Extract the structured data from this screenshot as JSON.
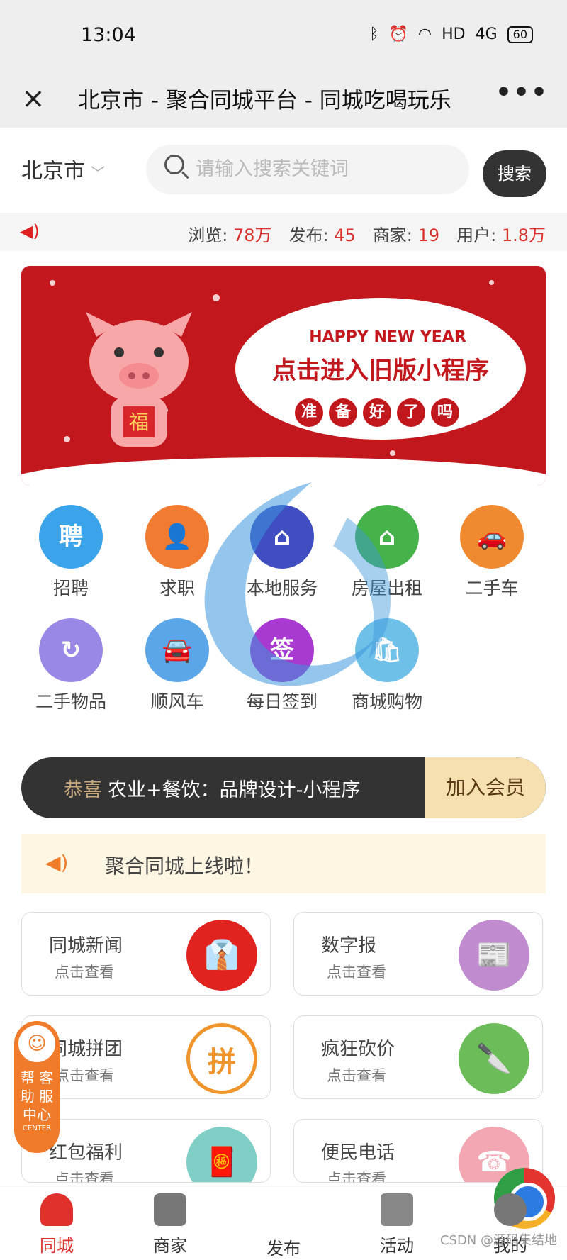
{
  "statusbar": {
    "time": "13:04",
    "network": "HD",
    "signal": "4G",
    "battery": "60"
  },
  "titlebar": {
    "close_label": "×",
    "title": "北京市 - 聚合同城平台 - 同城吃喝玩乐",
    "more_label": "•••"
  },
  "search": {
    "city": "北京市",
    "placeholder": "请输入搜索关键词",
    "button": "搜索"
  },
  "stats": [
    {
      "label": "浏览:",
      "value": "78万"
    },
    {
      "label": "发布:",
      "value": "45"
    },
    {
      "label": "商家:",
      "value": "19"
    },
    {
      "label": "用户:",
      "value": "1.8万"
    }
  ],
  "banner": {
    "headline": "HAPPY NEW YEAR",
    "main": "点击进入旧版小程序",
    "badges": [
      "准",
      "备",
      "好",
      "了",
      "吗"
    ],
    "pig_label": "福"
  },
  "grid": [
    {
      "label": "招聘",
      "glyph": "聘",
      "color": "#3aa3ea"
    },
    {
      "label": "求职",
      "glyph": "👤",
      "color": "#f27b32"
    },
    {
      "label": "本地服务",
      "glyph": "⌂",
      "color": "#3f4fc2"
    },
    {
      "label": "房屋出租",
      "glyph": "⌂",
      "color": "#46b24a"
    },
    {
      "label": "二手车",
      "glyph": "🚗",
      "color": "#f08a30"
    },
    {
      "label": "二手物品",
      "glyph": "↻",
      "color": "#9b88e6"
    },
    {
      "label": "顺风车",
      "glyph": "🚘",
      "color": "#5aa6e8"
    },
    {
      "label": "每日签到",
      "glyph": "签",
      "color": "#a93ad1"
    },
    {
      "label": "商城购物",
      "glyph": "🛍",
      "color": "#6fc0e8"
    }
  ],
  "member": {
    "congrats": "恭喜",
    "ticker": "农业+餐饮：品牌设计-小程序",
    "join": "加入会员"
  },
  "notice": {
    "text": "聚合同城上线啦！"
  },
  "cards": [
    {
      "title": "同城新闻",
      "sub": "点击查看",
      "color": "#e1231f",
      "glyph": "👔"
    },
    {
      "title": "数字报",
      "sub": "点击查看",
      "color": "#c08ccf",
      "glyph": "📰"
    },
    {
      "title": "同城拼团",
      "sub": "点击查看",
      "color": "#ffffff",
      "glyph": "拼"
    },
    {
      "title": "疯狂砍价",
      "sub": "点击查看",
      "color": "#6cbd5a",
      "glyph": "🔪"
    },
    {
      "title": "红包福利",
      "sub": "点击查看",
      "color": "#7fcfc7",
      "glyph": "🧧"
    },
    {
      "title": "便民电话",
      "sub": "点击查看",
      "color": "#f2a7b3",
      "glyph": "☎"
    }
  ],
  "help": {
    "line1": "帮 客",
    "line2": "助 服",
    "line3": "中心",
    "line4": "CENTER"
  },
  "tabs": [
    "同城",
    "商家",
    "发布",
    "活动",
    "我的"
  ],
  "watermark": "CSDN @源码集结地"
}
